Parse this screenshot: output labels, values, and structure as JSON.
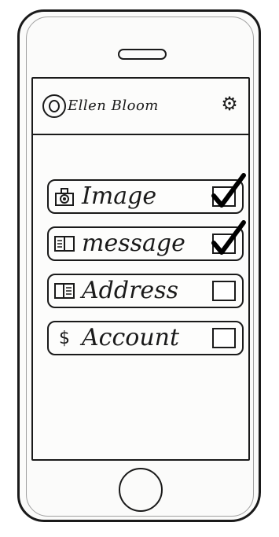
{
  "header": {
    "user_name": "Ellen Bloom",
    "avatar_icon": "user-avatar-icon",
    "settings_icon": "gear-icon"
  },
  "options": [
    {
      "label": "Image",
      "icon": "camera-icon",
      "checked": true
    },
    {
      "label": "message",
      "icon": "message-icon",
      "checked": true
    },
    {
      "label": "Address",
      "icon": "address-book-icon",
      "checked": false
    },
    {
      "label": "Account",
      "icon": "dollar-icon",
      "icon_glyph": "$",
      "checked": false
    }
  ],
  "device": {
    "home_button_icon": "home-button",
    "speaker_icon": "speaker-slot"
  }
}
